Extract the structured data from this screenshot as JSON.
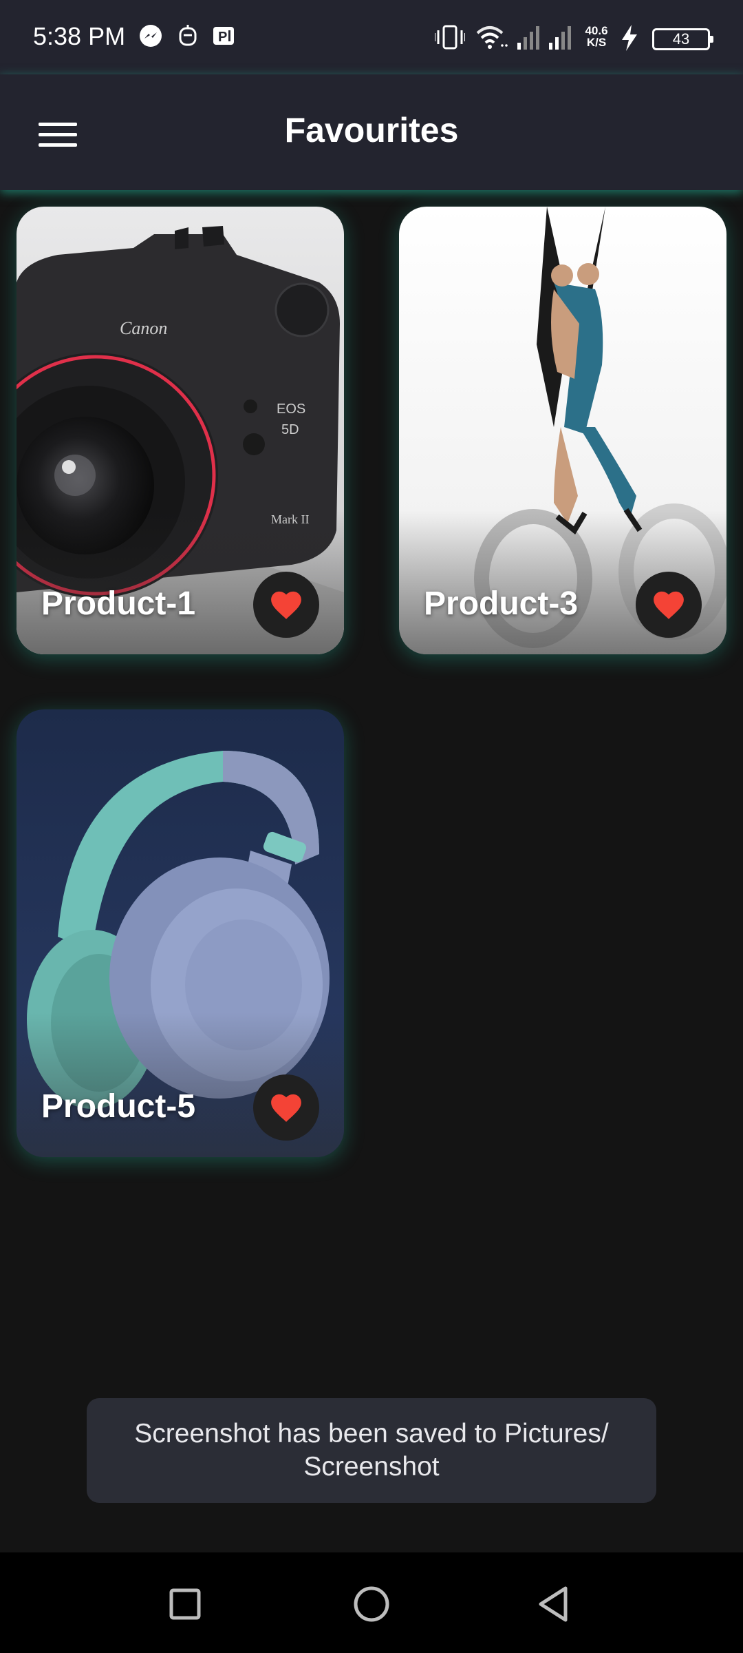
{
  "status_bar": {
    "time": "5:38 PM",
    "left_icons": [
      "messenger-icon",
      "assistant-icon",
      "parking-app-icon"
    ],
    "right_icons": [
      "vibrate-icon",
      "wifi-icon",
      "signal-icon",
      "signal-icon",
      "charging-icon"
    ],
    "net_speed_value": "40.6",
    "net_speed_unit": "K/S",
    "battery_level": "43"
  },
  "app_bar": {
    "title": "Favourites",
    "menu_icon": "hamburger-menu-icon"
  },
  "products": [
    {
      "name": "Product-1",
      "favorite": true,
      "image": "camera"
    },
    {
      "name": "Product-3",
      "favorite": true,
      "image": "scissors"
    },
    {
      "name": "Product-5",
      "favorite": true,
      "image": "headphones"
    }
  ],
  "toast": {
    "line1": "Screenshot has been saved to  Pictures/",
    "line2": "Screenshot"
  },
  "nav_bar": {
    "buttons": [
      "recents-square-icon",
      "home-circle-icon",
      "back-triangle-icon"
    ]
  },
  "colors": {
    "app_bar": "#23242f",
    "background": "#141414",
    "heart": "#f44336",
    "accent_glow": "#2ad2b4"
  }
}
